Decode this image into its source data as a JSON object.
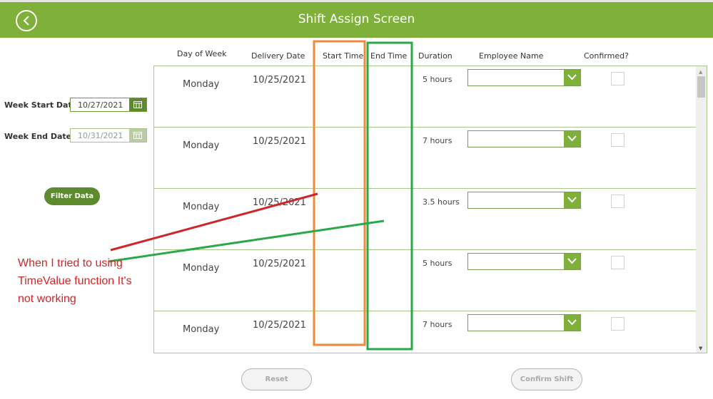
{
  "header": {
    "title": "Shift Assign Screen",
    "back_icon": "chevron-left-circle-icon",
    "color": "#7fb03a"
  },
  "filters": {
    "week_start_label": "Week Start Date",
    "week_start_value": "10/27/2021",
    "week_end_label": "Week End Date",
    "week_end_value": "10/31/2021",
    "calendar_icon": "calendar-icon",
    "filter_button": "Filter Data"
  },
  "columns": [
    "Day of Week",
    "Delivery Date",
    "Start Time",
    "End Time",
    "Duration",
    "Employee Name",
    "Confirmed?"
  ],
  "rows": [
    {
      "day": "Monday",
      "date": "10/25/2021",
      "start": "",
      "end": "",
      "duration": "5 hours",
      "employee": "",
      "confirmed": false
    },
    {
      "day": "Monday",
      "date": "10/25/2021",
      "start": "",
      "end": "",
      "duration": "7 hours",
      "employee": "",
      "confirmed": false
    },
    {
      "day": "Monday",
      "date": "10/25/2021",
      "start": "",
      "end": "",
      "duration": "3.5 hours",
      "employee": "",
      "confirmed": false
    },
    {
      "day": "Monday",
      "date": "10/25/2021",
      "start": "",
      "end": "",
      "duration": "5 hours",
      "employee": "",
      "confirmed": false
    },
    {
      "day": "Monday",
      "date": "10/25/2021",
      "start": "",
      "end": "",
      "duration": "7 hours",
      "employee": "",
      "confirmed": false
    }
  ],
  "footer": {
    "reset": "Reset",
    "confirm": "Confirm Shift"
  },
  "annotation": {
    "text": "When I tried to using TimeValue function It's not working",
    "color": "#d0262a",
    "start_time_highlight": "#f08a3a",
    "end_time_highlight": "#2aa84a"
  }
}
